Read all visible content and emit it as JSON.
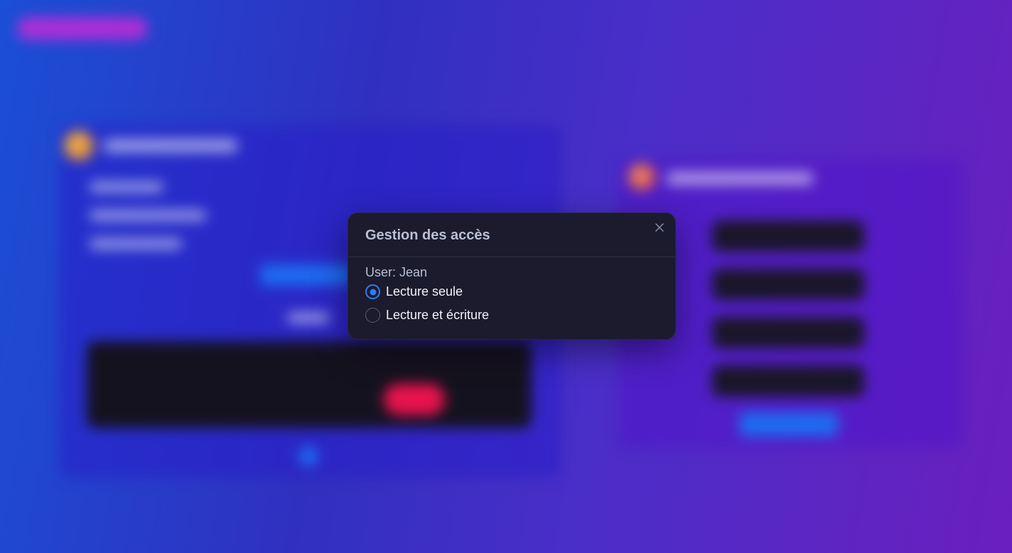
{
  "modal": {
    "title": "Gestion des accès",
    "user_line": "User: Jean",
    "options": [
      {
        "label": "Lecture seule",
        "checked": true
      },
      {
        "label": "Lecture et écriture",
        "checked": false
      }
    ],
    "close_icon": "close-icon"
  },
  "colors": {
    "accent": "#2f7cf6",
    "modal_bg": "#1b1b2d",
    "background_gradient_start": "#1b4fd6",
    "background_gradient_end": "#6a1fbf",
    "danger_pill": "#e8124e"
  }
}
